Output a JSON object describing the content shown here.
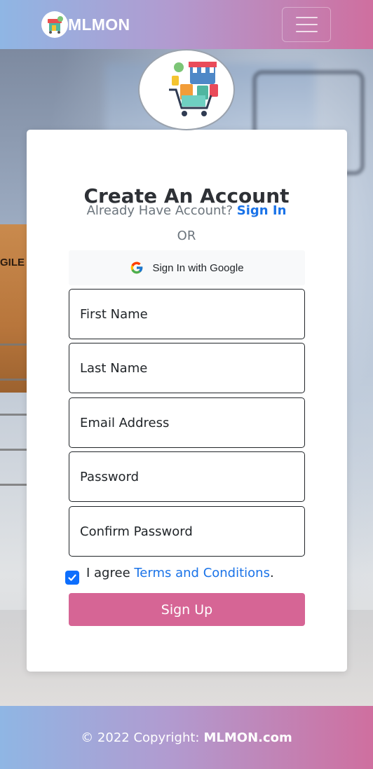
{
  "header": {
    "brand": "MLMON",
    "logo_icon": "shop-logo-icon",
    "menu_icon": "hamburger-menu-icon"
  },
  "hero": {
    "box_label": "GILE",
    "avatar_icon": "online-shopping-illustration"
  },
  "form": {
    "title": "Create An Account",
    "already_text": "Already Have Account?",
    "signin_link": "Sign In",
    "or_text": "OR",
    "google_label": "Sign In with Google",
    "fields": [
      {
        "name": "first-name",
        "placeholder": "First Name",
        "type": "text"
      },
      {
        "name": "last-name",
        "placeholder": "Last Name",
        "type": "text"
      },
      {
        "name": "email-address",
        "placeholder": "Email Address",
        "type": "email"
      },
      {
        "name": "password",
        "placeholder": "Password",
        "type": "password"
      },
      {
        "name": "confirm-password",
        "placeholder": "Confirm Password",
        "type": "password"
      }
    ],
    "agree_prefix": "I agree",
    "terms_link": "Terms and Conditions",
    "agree_suffix": ".",
    "agree_checked": true,
    "submit_label": "Sign Up"
  },
  "footer": {
    "copyright": "© 2022 Copyright:",
    "brand": "MLMON.com"
  },
  "colors": {
    "gradient_start": "#8fb6e4",
    "gradient_mid": "#b19bd0",
    "gradient_end": "#cf6f9f",
    "primary_button": "#d66595",
    "link": "#1a73e8",
    "checkbox": "#0d6efd"
  }
}
